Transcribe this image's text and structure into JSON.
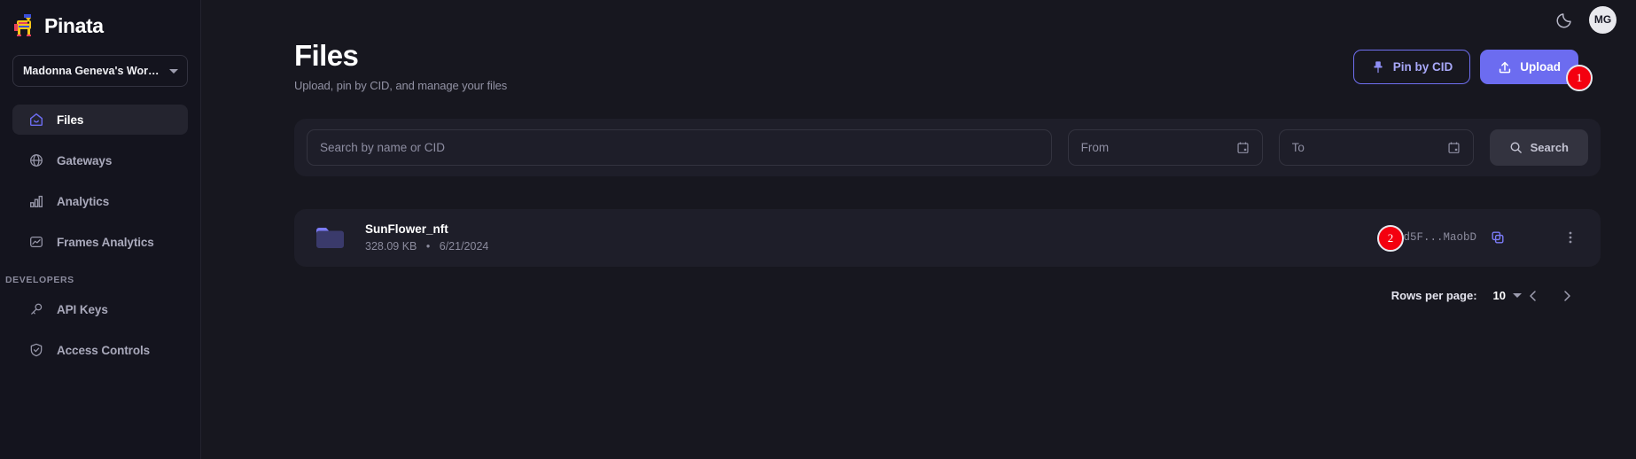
{
  "brand": {
    "name": "Pinata",
    "logo_icon": "pinata-logo-icon"
  },
  "sidebar": {
    "workspace": {
      "label": "Madonna Geneva's Worksp...",
      "caret_icon": "chevron-down-icon"
    },
    "items": [
      {
        "label": "Files",
        "icon": "home-files-icon",
        "active": true
      },
      {
        "label": "Gateways",
        "icon": "globe-icon",
        "active": false
      },
      {
        "label": "Analytics",
        "icon": "bar-chart-icon",
        "active": false
      },
      {
        "label": "Frames Analytics",
        "icon": "image-trend-icon",
        "active": false
      }
    ],
    "section_title": "DEVELOPERS",
    "dev_items": [
      {
        "label": "API Keys",
        "icon": "key-icon"
      },
      {
        "label": "Access Controls",
        "icon": "shield-check-icon"
      }
    ]
  },
  "topbar": {
    "theme_toggle_icon": "moon-icon",
    "avatar_initials": "MG"
  },
  "page": {
    "title": "Files",
    "subtitle": "Upload, pin by CID, and manage your files"
  },
  "actions": {
    "pin_by_cid": {
      "label": "Pin by CID",
      "icon": "pin-icon"
    },
    "upload": {
      "label": "Upload",
      "icon": "upload-icon"
    }
  },
  "search": {
    "name_placeholder": "Search by name or CID",
    "name_value": "",
    "from_placeholder": "From",
    "from_value": "",
    "to_placeholder": "To",
    "to_value": "",
    "calendar_icon": "calendar-icon",
    "button_label": "Search",
    "button_icon": "magnifier-icon"
  },
  "files": [
    {
      "icon": "folder-icon",
      "name": "SunFlower_nft",
      "size": "328.09 KB",
      "separator": "•",
      "date": "6/21/2024",
      "cid": "Qmd5F...MaobD",
      "copy_icon": "copy-icon",
      "menu_icon": "kebab-menu-icon"
    }
  ],
  "pagination": {
    "rows_label": "Rows per page:",
    "rows_value": "10",
    "prev_icon": "chevron-left-icon",
    "next_icon": "chevron-right-icon"
  },
  "markers": [
    {
      "id": "1",
      "label": "1"
    },
    {
      "id": "2",
      "label": "2"
    }
  ],
  "colors": {
    "accent": "#6c6cf0",
    "accent_light": "#a8a8f8",
    "marker_red": "#f4000f",
    "sidebar_bg": "#14141e",
    "main_bg": "#17171f",
    "panel_bg": "#1e1e29"
  }
}
